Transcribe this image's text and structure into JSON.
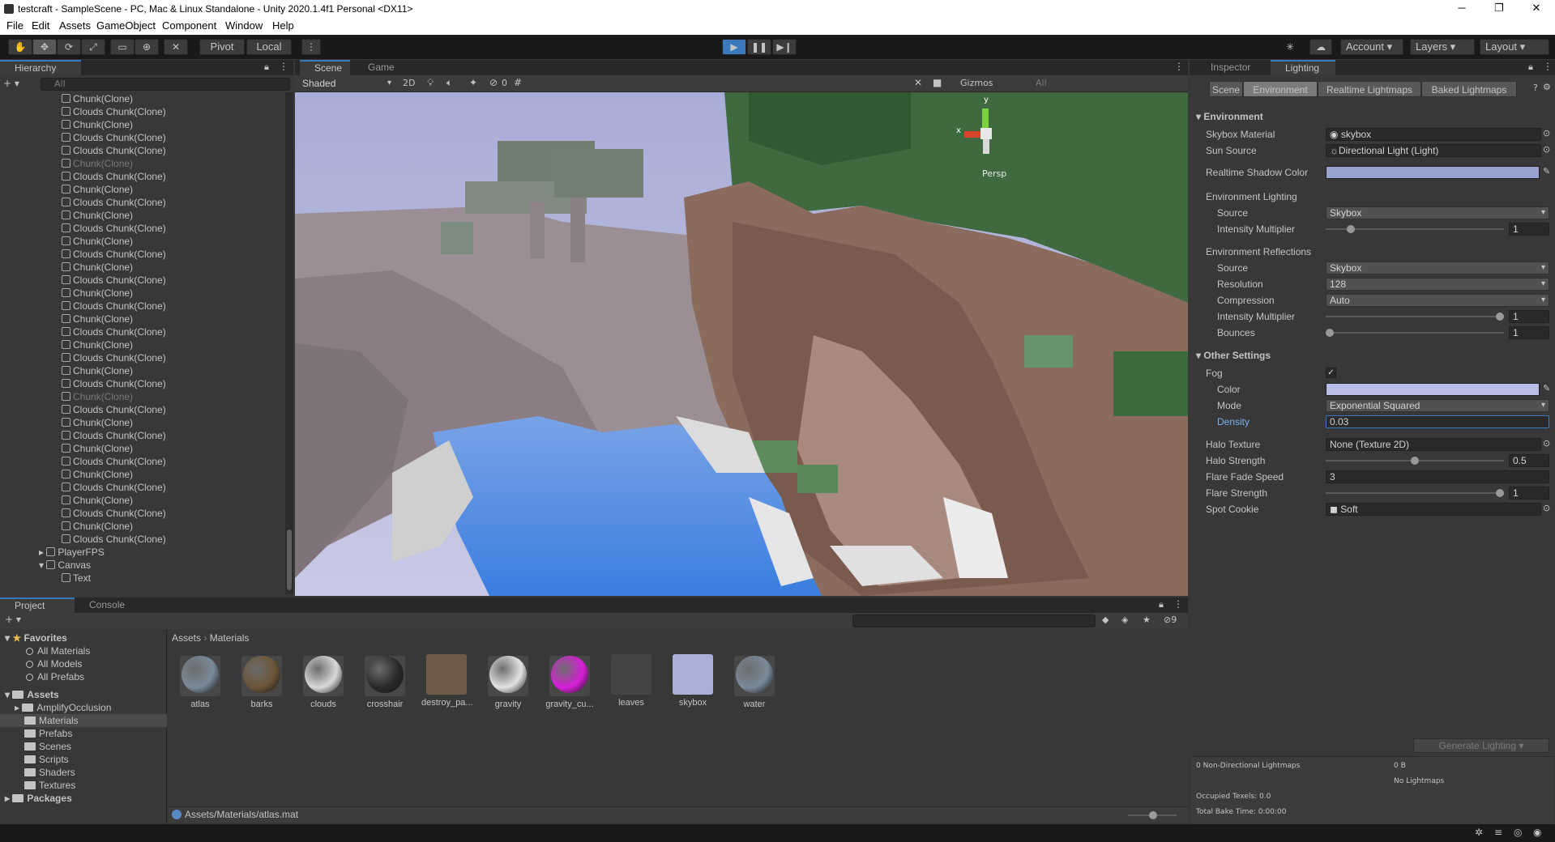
{
  "window": {
    "title": "testcraft - SampleScene - PC, Mac & Linux Standalone - Unity 2020.1.4f1 Personal <DX11>",
    "minimize": "─",
    "maximize": "❐",
    "close": "✕"
  },
  "menu": [
    "File",
    "Edit",
    "Assets",
    "GameObject",
    "Component",
    "Window",
    "Help"
  ],
  "toolbar": {
    "pivot": "Pivot",
    "local": "Local",
    "account": "Account",
    "layers": "Layers",
    "layout": "Layout"
  },
  "hierarchy": {
    "tab": "Hierarchy",
    "search_placeholder": "All",
    "items": [
      {
        "label": "Chunk(Clone)",
        "dim": false
      },
      {
        "label": "Clouds Chunk(Clone)",
        "dim": false
      },
      {
        "label": "Chunk(Clone)",
        "dim": false
      },
      {
        "label": "Clouds Chunk(Clone)",
        "dim": false
      },
      {
        "label": "Clouds Chunk(Clone)",
        "dim": false
      },
      {
        "label": "Chunk(Clone)",
        "dim": true
      },
      {
        "label": "Clouds Chunk(Clone)",
        "dim": false
      },
      {
        "label": "Chunk(Clone)",
        "dim": false
      },
      {
        "label": "Clouds Chunk(Clone)",
        "dim": false
      },
      {
        "label": "Chunk(Clone)",
        "dim": false
      },
      {
        "label": "Clouds Chunk(Clone)",
        "dim": false
      },
      {
        "label": "Chunk(Clone)",
        "dim": false
      },
      {
        "label": "Clouds Chunk(Clone)",
        "dim": false
      },
      {
        "label": "Chunk(Clone)",
        "dim": false
      },
      {
        "label": "Clouds Chunk(Clone)",
        "dim": false
      },
      {
        "label": "Chunk(Clone)",
        "dim": false
      },
      {
        "label": "Clouds Chunk(Clone)",
        "dim": false
      },
      {
        "label": "Chunk(Clone)",
        "dim": false
      },
      {
        "label": "Clouds Chunk(Clone)",
        "dim": false
      },
      {
        "label": "Chunk(Clone)",
        "dim": false
      },
      {
        "label": "Clouds Chunk(Clone)",
        "dim": false
      },
      {
        "label": "Chunk(Clone)",
        "dim": false
      },
      {
        "label": "Clouds Chunk(Clone)",
        "dim": false
      },
      {
        "label": "Chunk(Clone)",
        "dim": true
      },
      {
        "label": "Clouds Chunk(Clone)",
        "dim": false
      },
      {
        "label": "Chunk(Clone)",
        "dim": false
      },
      {
        "label": "Clouds Chunk(Clone)",
        "dim": false
      },
      {
        "label": "Chunk(Clone)",
        "dim": false
      },
      {
        "label": "Clouds Chunk(Clone)",
        "dim": false
      },
      {
        "label": "Chunk(Clone)",
        "dim": false
      },
      {
        "label": "Clouds Chunk(Clone)",
        "dim": false
      },
      {
        "label": "Chunk(Clone)",
        "dim": false
      },
      {
        "label": "Clouds Chunk(Clone)",
        "dim": false
      },
      {
        "label": "Chunk(Clone)",
        "dim": false
      },
      {
        "label": "Clouds Chunk(Clone)",
        "dim": false
      }
    ],
    "roots": [
      {
        "label": "PlayerFPS"
      },
      {
        "label": "Canvas"
      },
      {
        "label": "Text"
      }
    ]
  },
  "scene": {
    "tabs": [
      "Scene",
      "Game"
    ],
    "shading": "Shaded",
    "mode2d": "2D",
    "hidden_count": "0",
    "gizmos": "Gizmos",
    "search_placeholder": "All",
    "gizmo_y": "y",
    "gizmo_x": "x",
    "persp": "Persp"
  },
  "inspector": {
    "tabs": [
      "Inspector",
      "Lighting"
    ],
    "subtabs": [
      "Scene",
      "Environment",
      "Realtime Lightmaps",
      "Baked Lightmaps"
    ],
    "environment_header": "Environment",
    "skybox_material_label": "Skybox Material",
    "skybox_material_value": "skybox",
    "sun_source_label": "Sun Source",
    "sun_source_value": "Directional Light (Light)",
    "realtime_shadow_color_label": "Realtime Shadow Color",
    "shadow_color": "#9aa3d0",
    "env_lighting_label": "Environment Lighting",
    "source_label": "Source",
    "source_value": "Skybox",
    "intensity_label": "Intensity Multiplier",
    "intensity_value": "1",
    "env_reflections_label": "Environment Reflections",
    "refl_source_label": "Source",
    "refl_source_value": "Skybox",
    "resolution_label": "Resolution",
    "resolution_value": "128",
    "compression_label": "Compression",
    "compression_value": "Auto",
    "refl_intensity_label": "Intensity Multiplier",
    "refl_intensity_value": "1",
    "bounces_label": "Bounces",
    "bounces_value": "1",
    "other_header": "Other Settings",
    "fog_label": "Fog",
    "fog_checked": "✓",
    "color_label": "Color",
    "fog_color": "#b9bde8",
    "mode_label": "Mode",
    "mode_value": "Exponential Squared",
    "density_label": "Density",
    "density_value": "0.03",
    "halo_texture_label": "Halo Texture",
    "halo_texture_value": "None (Texture 2D)",
    "halo_strength_label": "Halo Strength",
    "halo_strength_value": "0.5",
    "flare_fade_label": "Flare Fade Speed",
    "flare_fade_value": "3",
    "flare_strength_label": "Flare Strength",
    "flare_strength_value": "1",
    "spot_cookie_label": "Spot Cookie",
    "spot_cookie_value": "Soft",
    "generate_button": "Generate Lighting",
    "stats_lightmaps": "0 Non-Directional Lightmaps",
    "stats_size": "0 B",
    "stats_no_lightmaps": "No Lightmaps",
    "stats_texels": "Occupied Texels: 0.0",
    "stats_bake_time": "Total Bake Time: 0:00:00"
  },
  "project": {
    "tabs": [
      "Project",
      "Console"
    ],
    "favorites_label": "Favorites",
    "favorites": [
      "All Materials",
      "All Models",
      "All Prefabs"
    ],
    "assets_label": "Assets",
    "folders": [
      "AmplifyOcclusion",
      "Materials",
      "Prefabs",
      "Scenes",
      "Scripts",
      "Shaders",
      "Textures"
    ],
    "packages_label": "Packages",
    "breadcrumb": [
      "Assets",
      "Materials"
    ],
    "breadcrumb_sep": "›",
    "hidden_count": "9",
    "assets": [
      {
        "name": "atlas",
        "kind": "sphere",
        "color": "#7a8a9a"
      },
      {
        "name": "barks",
        "kind": "sphere",
        "color": "#6b5538"
      },
      {
        "name": "clouds",
        "kind": "sphere",
        "color": "#d8d8d8"
      },
      {
        "name": "crosshair",
        "kind": "sphere",
        "color": "#2a2a2a"
      },
      {
        "name": "destroy_pa...",
        "kind": "square",
        "color": "#6f5a48"
      },
      {
        "name": "gravity",
        "kind": "sphere",
        "color": "#e2e2e2"
      },
      {
        "name": "gravity_cu...",
        "kind": "sphere",
        "color": "#d61fd6"
      },
      {
        "name": "leaves",
        "kind": "square",
        "color": "#444444"
      },
      {
        "name": "skybox",
        "kind": "square",
        "color": "#aab0d8"
      },
      {
        "name": "water",
        "kind": "sphere",
        "color": "#7a8a9a"
      }
    ],
    "status_path": "Assets/Materials/atlas.mat"
  }
}
